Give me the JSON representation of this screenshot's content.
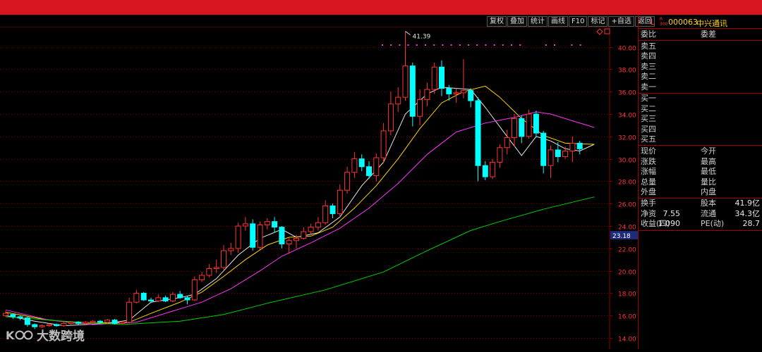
{
  "toolbar": {
    "buttons": [
      "复权",
      "叠加",
      "统计",
      "画线",
      "F10",
      "标记",
      "+自选",
      "返回"
    ]
  },
  "chart_data": {
    "type": "candlestick",
    "y_ticks": [
      "40.00",
      "38.00",
      "36.00",
      "34.00",
      "32.00",
      "30.00",
      "28.00",
      "26.00",
      "24.00",
      "22.00",
      "20.00",
      "18.00",
      "16.00",
      "14.00"
    ],
    "ylim": [
      13.0,
      41.8
    ],
    "high_label": "41.39",
    "current_price_label": "23.18",
    "colors": {
      "up": "#ff3232",
      "down": "#00ffff",
      "ma1": "#e8e8e8",
      "ma2": "#ffd400",
      "ma3": "#ff33ff",
      "ma4": "#00d000",
      "grid": "#8a0000",
      "marker": "#ff33ff"
    },
    "candles": [
      [
        16.0,
        16.2,
        16.4,
        15.9
      ],
      [
        16.1,
        15.9,
        16.2,
        15.7
      ],
      [
        15.9,
        15.8,
        16.0,
        15.6
      ],
      [
        15.8,
        15.2,
        15.9,
        15.0
      ],
      [
        15.2,
        15.0,
        15.3,
        14.8
      ],
      [
        15.0,
        15.1,
        15.2,
        14.9
      ],
      [
        15.1,
        15.2,
        15.3,
        15.0
      ],
      [
        15.2,
        15.1,
        15.3,
        15.0
      ],
      [
        15.1,
        15.3,
        15.4,
        15.0
      ],
      [
        15.3,
        15.4,
        15.5,
        15.2
      ],
      [
        15.4,
        15.3,
        15.5,
        15.2
      ],
      [
        15.3,
        15.4,
        15.5,
        15.2
      ],
      [
        15.4,
        15.5,
        15.6,
        15.3
      ],
      [
        15.5,
        15.4,
        15.6,
        15.3
      ],
      [
        15.4,
        15.6,
        15.7,
        15.3
      ],
      [
        15.6,
        15.3,
        15.7,
        15.2
      ],
      [
        15.3,
        15.4,
        15.5,
        15.2
      ],
      [
        15.4,
        17.2,
        17.6,
        15.3
      ],
      [
        17.2,
        18.0,
        18.3,
        17.1
      ],
      [
        18.0,
        17.4,
        18.1,
        17.3
      ],
      [
        17.4,
        17.3,
        17.6,
        17.1
      ],
      [
        17.3,
        17.6,
        17.9,
        17.2
      ],
      [
        17.6,
        17.3,
        17.8,
        17.2
      ],
      [
        17.3,
        17.9,
        18.1,
        17.2
      ],
      [
        17.9,
        17.6,
        18.2,
        17.5
      ],
      [
        17.6,
        17.4,
        17.7,
        17.0
      ],
      [
        17.4,
        19.2,
        19.5,
        17.3
      ],
      [
        19.2,
        19.6,
        19.9,
        19.0
      ],
      [
        19.6,
        20.2,
        20.6,
        19.4
      ],
      [
        20.2,
        20.3,
        21.0,
        19.8
      ],
      [
        20.3,
        21.8,
        22.3,
        20.1
      ],
      [
        21.8,
        22.0,
        22.5,
        21.4
      ],
      [
        22.0,
        24.0,
        24.3,
        21.6
      ],
      [
        24.0,
        24.2,
        24.8,
        23.6
      ],
      [
        24.2,
        22.1,
        24.6,
        21.8
      ],
      [
        22.1,
        24.1,
        24.4,
        21.9
      ],
      [
        24.1,
        24.4,
        24.7,
        23.7
      ],
      [
        24.4,
        23.9,
        24.8,
        23.4
      ],
      [
        23.9,
        22.4,
        24.0,
        22.0
      ],
      [
        22.4,
        22.7,
        23.0,
        21.5
      ],
      [
        22.7,
        22.9,
        23.2,
        22.0
      ],
      [
        22.9,
        23.5,
        23.9,
        22.8
      ],
      [
        23.5,
        23.9,
        24.2,
        23.3
      ],
      [
        23.9,
        24.3,
        24.8,
        23.6
      ],
      [
        24.3,
        25.8,
        26.3,
        24.1
      ],
      [
        25.8,
        25.1,
        26.0,
        24.7
      ],
      [
        25.1,
        27.2,
        27.7,
        24.9
      ],
      [
        27.2,
        28.8,
        29.3,
        26.9
      ],
      [
        28.8,
        30.0,
        30.6,
        28.3
      ],
      [
        30.0,
        29.3,
        30.4,
        28.9
      ],
      [
        29.3,
        28.5,
        29.8,
        28.2
      ],
      [
        28.5,
        30.1,
        30.5,
        28.0
      ],
      [
        30.1,
        32.5,
        33.2,
        29.6
      ],
      [
        32.5,
        34.9,
        36.0,
        32.1
      ],
      [
        34.9,
        35.5,
        36.4,
        34.2
      ],
      [
        35.5,
        38.3,
        41.39,
        35.2
      ],
      [
        38.3,
        33.8,
        38.6,
        32.9
      ],
      [
        33.8,
        35.3,
        36.2,
        33.0
      ],
      [
        35.3,
        36.2,
        36.8,
        34.7
      ],
      [
        36.2,
        38.2,
        38.6,
        35.8
      ],
      [
        38.2,
        36.3,
        38.8,
        35.6
      ],
      [
        36.3,
        35.8,
        36.6,
        35.2
      ],
      [
        35.8,
        35.9,
        36.3,
        35.0
      ],
      [
        35.9,
        36.1,
        38.9,
        35.4
      ],
      [
        36.1,
        35.2,
        36.3,
        34.6
      ],
      [
        35.2,
        29.4,
        35.5,
        28.0
      ],
      [
        29.4,
        28.4,
        29.8,
        28.1
      ],
      [
        28.4,
        29.7,
        30.0,
        28.2
      ],
      [
        29.7,
        31.0,
        31.3,
        29.2
      ],
      [
        31.0,
        31.9,
        32.6,
        30.4
      ],
      [
        31.9,
        33.6,
        34.0,
        31.1
      ],
      [
        33.6,
        32.0,
        33.9,
        31.4
      ],
      [
        32.0,
        34.0,
        34.4,
        31.8
      ],
      [
        34.0,
        32.3,
        34.3,
        31.9
      ],
      [
        32.3,
        29.4,
        32.5,
        28.7
      ],
      [
        29.4,
        30.8,
        31.2,
        28.3
      ],
      [
        30.8,
        30.2,
        31.5,
        29.7
      ],
      [
        30.2,
        30.7,
        31.1,
        30.0
      ],
      [
        30.7,
        31.4,
        32.0,
        29.7
      ],
      [
        31.4,
        30.9,
        31.6,
        30.4
      ]
    ],
    "ma_lines": [
      {
        "color": "ma1",
        "points": [
          [
            0,
            16.0
          ],
          [
            4,
            15.5
          ],
          [
            8,
            15.1
          ],
          [
            14,
            15.3
          ],
          [
            17,
            15.6
          ],
          [
            20,
            17.2
          ],
          [
            24,
            17.6
          ],
          [
            26,
            17.9
          ],
          [
            29,
            19.3
          ],
          [
            32,
            21.4
          ],
          [
            35,
            22.9
          ],
          [
            38,
            23.7
          ],
          [
            40,
            23.0
          ],
          [
            43,
            23.4
          ],
          [
            46,
            24.8
          ],
          [
            49,
            27.6
          ],
          [
            52,
            29.7
          ],
          [
            55,
            34.0
          ],
          [
            58,
            35.8
          ],
          [
            60,
            36.4
          ],
          [
            62,
            36.3
          ],
          [
            64,
            36.2
          ],
          [
            66,
            34.6
          ],
          [
            69,
            32.0
          ],
          [
            71,
            30.3
          ],
          [
            73,
            32.0
          ],
          [
            75,
            31.6
          ],
          [
            77,
            30.9
          ],
          [
            79,
            30.7
          ],
          [
            81,
            31.3
          ]
        ]
      },
      {
        "color": "ma2",
        "points": [
          [
            0,
            16.3
          ],
          [
            5,
            15.7
          ],
          [
            10,
            15.3
          ],
          [
            17,
            15.4
          ],
          [
            20,
            16.2
          ],
          [
            24,
            17.2
          ],
          [
            27,
            18.1
          ],
          [
            30,
            19.5
          ],
          [
            33,
            21.0
          ],
          [
            36,
            22.3
          ],
          [
            39,
            23.0
          ],
          [
            42,
            23.1
          ],
          [
            45,
            23.9
          ],
          [
            48,
            25.6
          ],
          [
            51,
            27.6
          ],
          [
            54,
            30.0
          ],
          [
            57,
            32.7
          ],
          [
            60,
            35.0
          ],
          [
            63,
            36.0
          ],
          [
            66,
            36.5
          ],
          [
            68,
            35.5
          ],
          [
            71,
            33.6
          ],
          [
            74,
            32.1
          ],
          [
            77,
            31.4
          ],
          [
            81,
            31.3
          ]
        ]
      },
      {
        "color": "ma3",
        "points": [
          [
            0,
            16.5
          ],
          [
            6,
            15.6
          ],
          [
            12,
            15.2
          ],
          [
            18,
            15.4
          ],
          [
            23,
            16.4
          ],
          [
            27,
            17.2
          ],
          [
            31,
            18.4
          ],
          [
            35,
            20.0
          ],
          [
            38,
            21.3
          ],
          [
            42,
            22.5
          ],
          [
            46,
            23.8
          ],
          [
            50,
            25.6
          ],
          [
            54,
            27.8
          ],
          [
            58,
            30.4
          ],
          [
            62,
            32.4
          ],
          [
            66,
            33.2
          ],
          [
            70,
            33.7
          ],
          [
            73,
            34.2
          ],
          [
            75,
            34.0
          ],
          [
            78,
            33.4
          ],
          [
            80,
            33.0
          ],
          [
            81,
            32.8
          ]
        ]
      },
      {
        "color": "ma4",
        "points": [
          [
            0,
            15.9
          ],
          [
            8,
            15.5
          ],
          [
            16,
            15.2
          ],
          [
            24,
            15.5
          ],
          [
            30,
            16.1
          ],
          [
            36,
            17.1
          ],
          [
            44,
            18.3
          ],
          [
            52,
            19.9
          ],
          [
            58,
            21.8
          ],
          [
            64,
            23.6
          ],
          [
            68,
            24.4
          ],
          [
            74,
            25.5
          ],
          [
            81,
            26.6
          ]
        ]
      }
    ]
  },
  "sidebar": {
    "stock_prefix": "L",
    "stock_code": "000063",
    "stock_name": "中兴通讯",
    "ratio_label": "委比",
    "diff_label": "委差",
    "sell_labels": [
      "卖五",
      "卖四",
      "卖三",
      "卖二",
      "卖一"
    ],
    "buy_labels": [
      "买一",
      "买二",
      "买三",
      "买四",
      "买五"
    ],
    "quote_rows": [
      [
        "现价",
        "今开"
      ],
      [
        "涨跌",
        "最高"
      ],
      [
        "涨幅",
        "最低"
      ],
      [
        "总量",
        "量比"
      ],
      [
        "外盘",
        "内盘"
      ]
    ],
    "fund_rows": [
      {
        "l1": "换手",
        "v1": "",
        "l2": "股本",
        "v2": "41.9亿"
      },
      {
        "l1": "净资",
        "v1": "7.55",
        "l2": "流通",
        "v2": "34.3亿"
      },
      {
        "l1": "收益(四)",
        "v1": "1.090",
        "l2": "PE(动)",
        "v2": "28.7"
      }
    ]
  },
  "watermark": {
    "text": "大数跨境",
    "logo": "KOO"
  }
}
